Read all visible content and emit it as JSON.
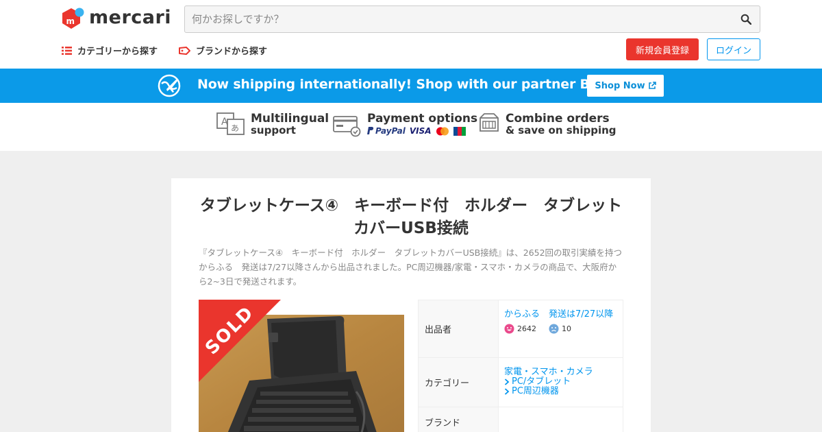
{
  "header": {
    "logo_text": "mercari",
    "search_placeholder": "何かお探しですか？",
    "nav_categories": "カテゴリーから探す",
    "nav_brands": "ブランドから探す",
    "signup_label": "新規会員登録",
    "login_label": "ログイン"
  },
  "banner": {
    "text": "Now shipping internationally! Shop with our partner Buyee!",
    "button_label": "Shop Now"
  },
  "features": [
    {
      "title": "Multilingual",
      "subtitle": "support"
    },
    {
      "title": "Payment options",
      "subtitle": "PayPal"
    },
    {
      "title": "Combine orders",
      "subtitle": "& save on shipping"
    }
  ],
  "payment_logos": {
    "visa": "VISA",
    "jcb": "JCB"
  },
  "item": {
    "title": "タブレットケース④　キーボード付　ホルダー　タブレットカバーUSB接続",
    "description": "『タブレットケース④　キーボード付　ホルダー　タブレットカバーUSB接続』は、2652回の取引実績を持つからふる　発送は7/27以降さんから出品されました。PC周辺機器/家電・スマホ・カメラの商品で、大阪府から2~3日で発送されます。",
    "sold_label": "SOLD",
    "details": {
      "seller_label": "出品者",
      "seller_name": "からふる　発送は7/27以降",
      "rating_good": "2642",
      "rating_bad": "10",
      "category_label": "カテゴリー",
      "category_main": "家電・スマホ・カメラ",
      "category_sub1": "PC/タブレット",
      "category_sub2": "PC周辺機器",
      "brand_label": "ブランド"
    }
  },
  "colors": {
    "brand_red": "#ea352d",
    "link_blue": "#0095ee",
    "banner_blue": "#0b9ae8"
  }
}
